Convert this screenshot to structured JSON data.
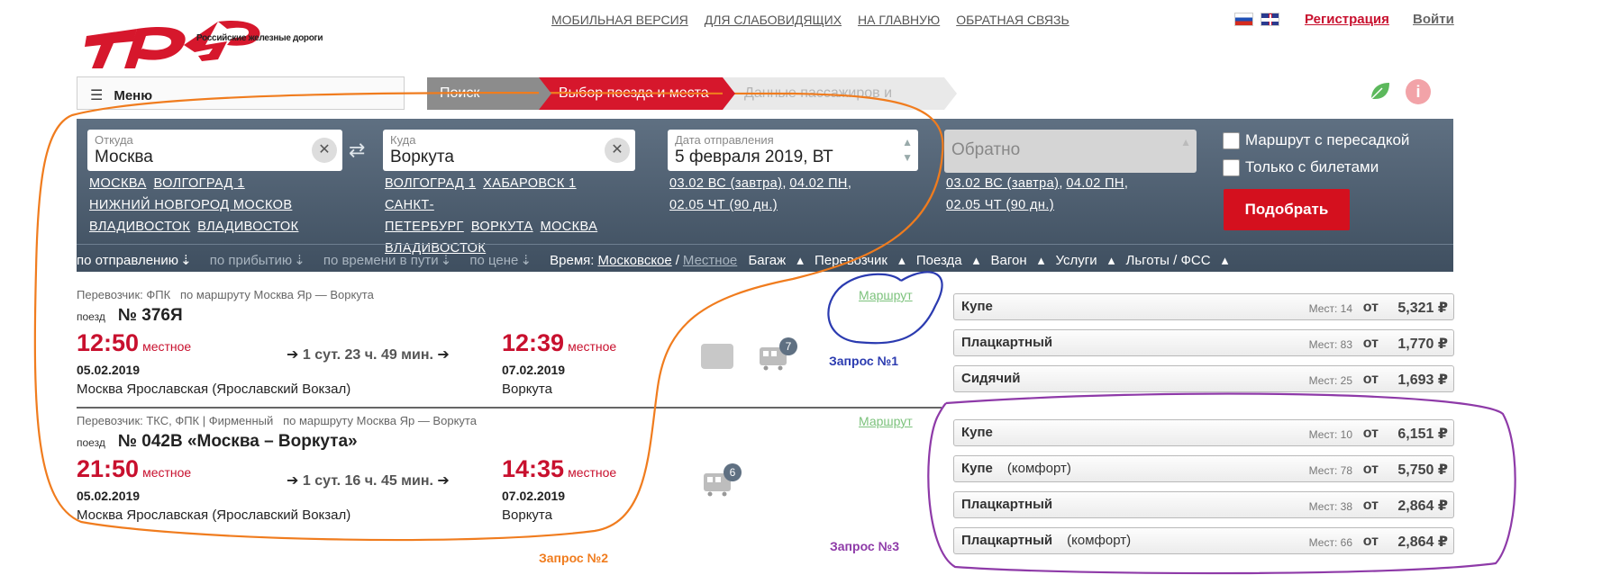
{
  "header": {
    "logo_text": "РЖД",
    "logo_subtitle": "Российские железные дороги",
    "top_links": [
      "МОБИЛЬНАЯ ВЕРСИЯ",
      "ДЛЯ СЛАБОВИДЯЩИХ",
      "НА ГЛАВНУЮ",
      "ОБРАТНАЯ СВЯЗЬ"
    ],
    "register": "Регистрация",
    "login": "Войти"
  },
  "menu": {
    "label": "Меню"
  },
  "steps": [
    "Поиск билета",
    "Выбор поезда и места",
    "Данные пассажиров и оплата"
  ],
  "search": {
    "from": {
      "label": "Откуда",
      "value": "Москва",
      "suggestions": [
        "МОСКВА",
        "ВОЛГОГРАД 1",
        "НИЖНИЙ НОВГОРОД МОСКОВ",
        "ВЛАДИВОСТОК",
        "ВЛАДИВОСТОК"
      ]
    },
    "to": {
      "label": "Куда",
      "value": "Воркута",
      "suggestions": [
        "ВОЛГОГРАД 1",
        "ХАБАРОВСК 1",
        "САНКТ-ПЕТЕРБУРГ",
        "ВОРКУТА",
        "МОСКВА",
        "ВЛАДИВОСТОК"
      ]
    },
    "date": {
      "label": "Дата отправления",
      "value": "5 февраля 2019, ВТ",
      "quick": [
        "03.02 ВС (завтра)",
        "04.02 ПН",
        "02.05 ЧТ (90 дн.)"
      ]
    },
    "back": {
      "placeholder": "Обратно",
      "quick": [
        "03.02 ВС (завтра)",
        "04.02 ПН",
        "02.05 ЧТ (90 дн.)"
      ]
    },
    "check_transfer": "Маршрут с пересадкой",
    "check_tickets": "Только с билетами",
    "find_button": "Подобрать"
  },
  "sort": {
    "by_departure": "по отправлению",
    "by_arrival": "по прибытию",
    "by_travel_time": "по времени в пути",
    "by_price": "по цене",
    "time_label": "Время:",
    "time_moscow": "Московское",
    "time_sep": "/",
    "time_local": "Местное",
    "filters": [
      "Багаж",
      "Перевозчик",
      "Поезда",
      "Вагон",
      "Услуги",
      "Льготы / ФСС"
    ]
  },
  "trains": [
    {
      "carrier": "Перевозчик: ФПК",
      "route": "по маршруту Москва Яр — Воркута",
      "train_prefix": "поезд",
      "number": "№ 376Я",
      "dep_time": "12:50",
      "dep_zone": "местное",
      "dep_date": "05.02.2019",
      "dep_station": "Москва Ярославская (Ярославский Вокзал)",
      "duration": "1 сут. 23 ч. 49 мин.",
      "arr_time": "12:39",
      "arr_zone": "местное",
      "arr_date": "07.02.2019",
      "arr_station": "Воркута",
      "route_link": "Маршрут",
      "cars_count": "7",
      "fares": [
        {
          "class": "Купе",
          "sub": "",
          "seats": "Мест: 14",
          "from": "от",
          "price": "5,321 ₽"
        },
        {
          "class": "Плацкартный",
          "sub": "",
          "seats": "Мест: 83",
          "from": "от",
          "price": "1,770 ₽"
        },
        {
          "class": "Сидячий",
          "sub": "",
          "seats": "Мест: 25",
          "from": "от",
          "price": "1,693 ₽"
        }
      ]
    },
    {
      "carrier": "Перевозчик: ТКС, ФПК | Фирменный",
      "route": "по маршруту Москва Яр — Воркута",
      "train_prefix": "поезд",
      "number": "№ 042В «Москва – Воркута»",
      "dep_time": "21:50",
      "dep_zone": "местное",
      "dep_date": "05.02.2019",
      "dep_station": "Москва Ярославская (Ярославский Вокзал)",
      "duration": "1 сут. 16 ч. 45 мин.",
      "arr_time": "14:35",
      "arr_zone": "местное",
      "arr_date": "07.02.2019",
      "arr_station": "Воркута",
      "route_link": "Маршрут",
      "cars_count": "6",
      "fares": [
        {
          "class": "Купе",
          "sub": "",
          "seats": "Мест: 10",
          "from": "от",
          "price": "6,151 ₽"
        },
        {
          "class": "Купе",
          "sub": "(комфорт)",
          "seats": "Мест: 78",
          "from": "от",
          "price": "5,750 ₽"
        },
        {
          "class": "Плацкартный",
          "sub": "",
          "seats": "Мест: 38",
          "from": "от",
          "price": "2,864 ₽"
        },
        {
          "class": "Плацкартный",
          "sub": "(комфорт)",
          "seats": "Мест: 66",
          "from": "от",
          "price": "2,864 ₽"
        }
      ]
    }
  ],
  "annotations": {
    "q1": "Запрос №1",
    "q2": "Запрос №2",
    "q3": "Запрос №3",
    "colors": {
      "orange": "#f07c1e",
      "blue": "#2b3bb0",
      "purple": "#8e3aa8"
    }
  },
  "colors": {
    "brand_red": "#d6172c",
    "panel": "#4f6072",
    "route_green": "#7cc27c"
  },
  "icons": [
    "menu-icon",
    "swap-icon",
    "clear-icon",
    "leaf-icon",
    "info-icon",
    "sort-arrow-icon",
    "pet-icon",
    "car-icon",
    "arrow-right-icon"
  ]
}
